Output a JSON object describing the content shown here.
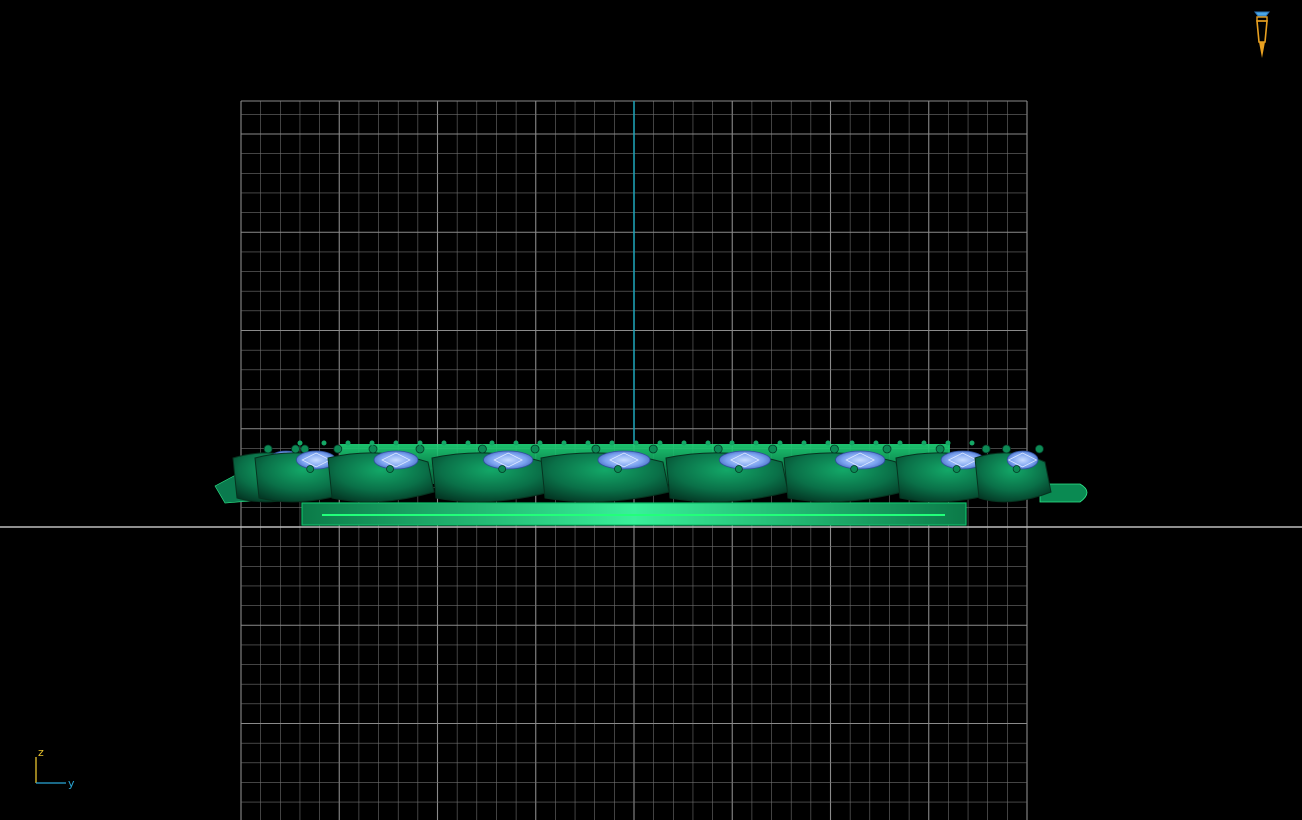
{
  "viewport": {
    "background": "#000000",
    "grid_color": "#6e6e6e",
    "grid_major_color": "#8a8a8a",
    "horizon_color": "#bdbdbd",
    "vertical_axis_color": "#1aa3b8"
  },
  "axis_triad": {
    "up_label": "z",
    "right_label": "y",
    "color": "#e8c22e",
    "right_color": "#2aa6d6"
  },
  "tool_icon": {
    "name": "paintbrush-icon",
    "color": "#e8a020",
    "accent": "#4aa8e8"
  },
  "model": {
    "name": "gemstone-ring-band",
    "body_color": "#0a7a4e",
    "highlight_color": "#2ee88a",
    "gem_color": "#8ab4ff",
    "stone_count": 9
  }
}
